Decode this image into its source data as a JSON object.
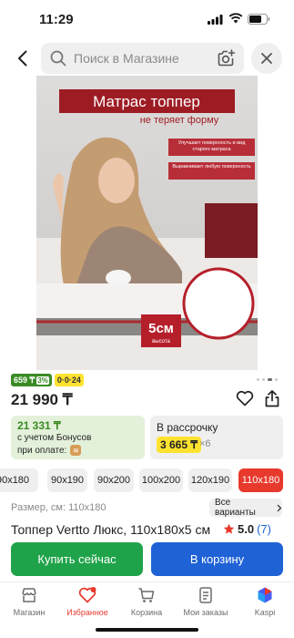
{
  "status_bar": {
    "time": "11:29"
  },
  "search": {
    "placeholder": "Поиск в Магазине"
  },
  "product_image": {
    "headline": "Матрас топпер",
    "subheadline": "не теряет форму",
    "feature_1": "Улучшает поверхность и вид старого матраса",
    "feature_2": "Выравнивает любую поверхность",
    "height_value": "5см",
    "height_label": "высота"
  },
  "badges": {
    "bonus": "659 ₸",
    "bonus_pct": "3%",
    "installment": "0·0·24"
  },
  "price": "21 990 ₸",
  "bonus_card": {
    "amount": "21 331 ₸",
    "line1": "с учетом Бонусов",
    "line2": "при оплате:"
  },
  "installment_card": {
    "label": "В рассрочку",
    "monthly": "3 665 ₸",
    "multiplier": "×6"
  },
  "sizes": [
    {
      "label": "90x180"
    },
    {
      "label": "90x190"
    },
    {
      "label": "90x200"
    },
    {
      "label": "100x200"
    },
    {
      "label": "120x190"
    },
    {
      "label": "110x180",
      "selected": true
    }
  ],
  "size_label": "Размер, см: 110x180",
  "all_variants": "Все варианты",
  "product": {
    "title": "Топпер Vertto Люкс, 110x180x5 см",
    "rating": "5.0",
    "reviews": "(7)"
  },
  "actions": {
    "buy_now": "Купить сейчас",
    "add_to_cart": "В корзину"
  },
  "tabbar": {
    "items": [
      {
        "label": "Магазин",
        "icon": "shop-icon"
      },
      {
        "label": "Избранное",
        "icon": "heart-icon",
        "active": true
      },
      {
        "label": "Корзина",
        "icon": "cart-icon"
      },
      {
        "label": "Мои заказы",
        "icon": "orders-icon"
      },
      {
        "label": "Kaspi",
        "icon": "kaspi-icon"
      }
    ]
  },
  "colors": {
    "accent": "#E8392D",
    "buy": "#1FA34A",
    "cart": "#1F62D6",
    "bonus": "#3A8B24",
    "highlight": "#FDE230"
  }
}
